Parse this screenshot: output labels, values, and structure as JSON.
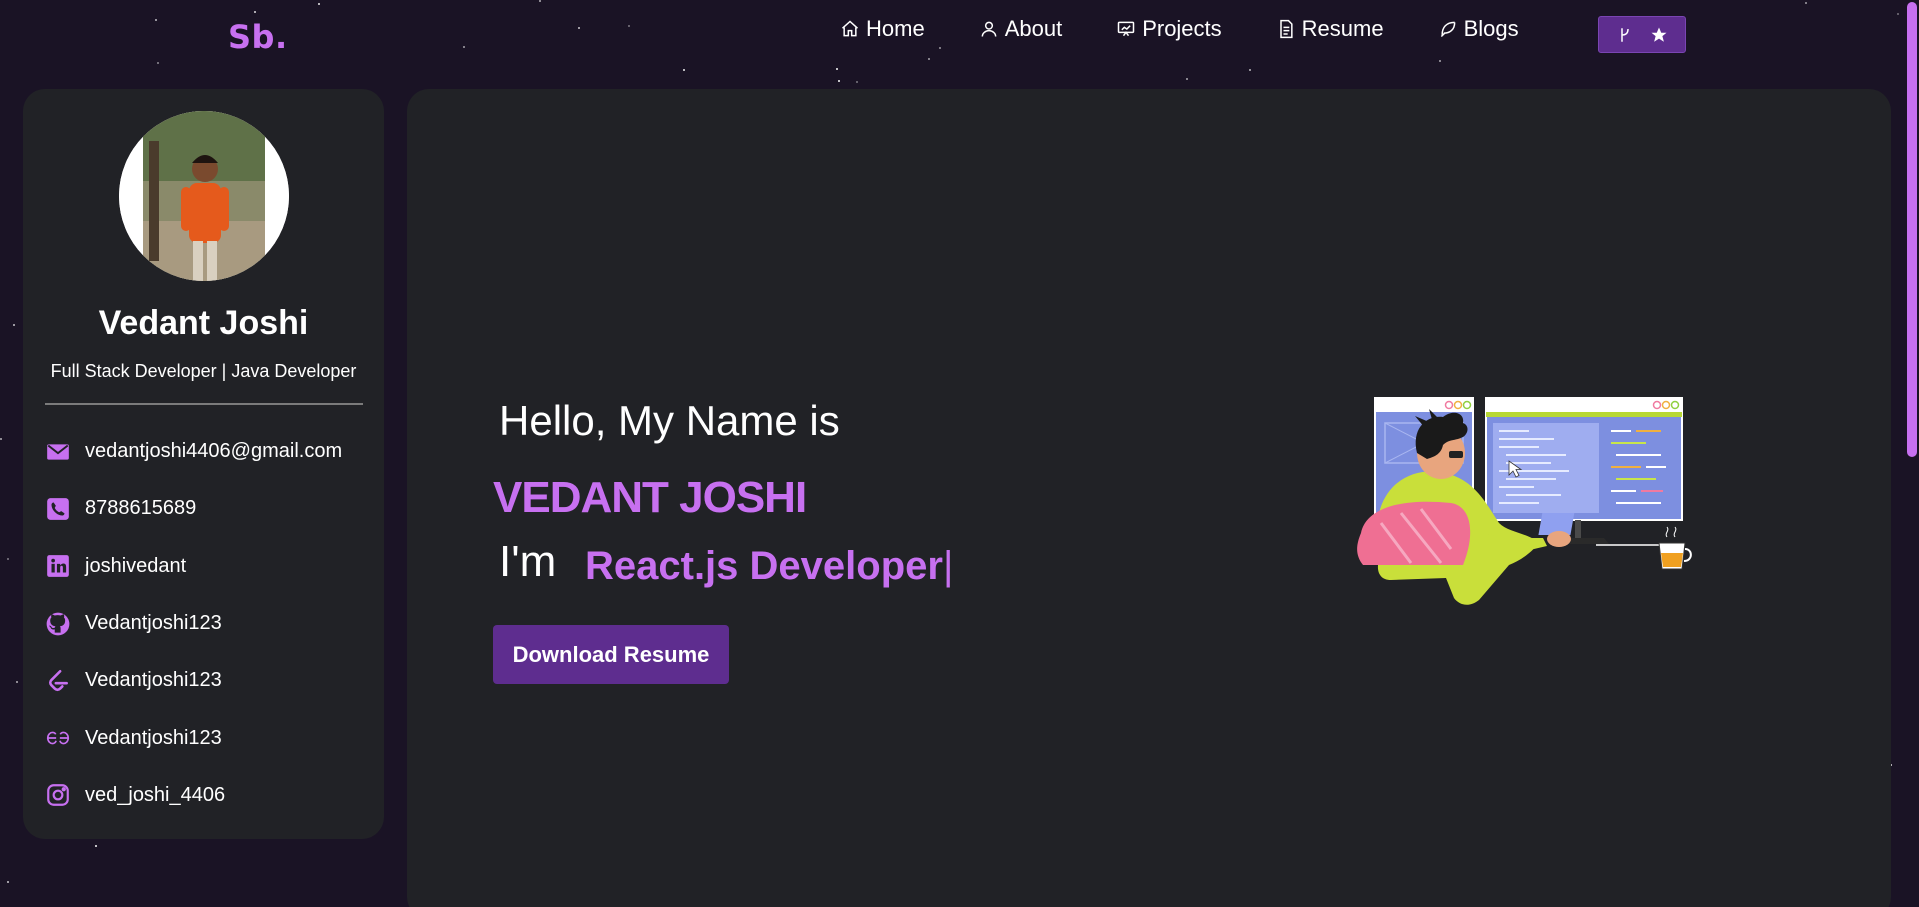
{
  "navbar": {
    "logo": "Sb.",
    "links": [
      {
        "label": "Home",
        "icon": "home-icon"
      },
      {
        "label": "About",
        "icon": "user-icon"
      },
      {
        "label": "Projects",
        "icon": "projects-icon"
      },
      {
        "label": "Resume",
        "icon": "document-icon"
      },
      {
        "label": "Blogs",
        "icon": "feather-icon"
      }
    ],
    "fork_button": {
      "icons": [
        "fork-icon",
        "star-icon"
      ]
    }
  },
  "sidebar": {
    "name": "Vedant Joshi",
    "role": "Full Stack Developer | Java Developer",
    "contacts": [
      {
        "icon": "mail-icon",
        "text": "vedantjoshi4406@gmail.com"
      },
      {
        "icon": "phone-icon",
        "text": "8788615689"
      },
      {
        "icon": "linkedin-icon",
        "text": "joshivedant"
      },
      {
        "icon": "github-icon",
        "text": "Vedantjoshi123"
      },
      {
        "icon": "leetcode-icon",
        "text": "Vedantjoshi123"
      },
      {
        "icon": "geeksforgeeks-icon",
        "text": "Vedantjoshi123"
      },
      {
        "icon": "instagram-icon",
        "text": "ved_joshi_4406"
      }
    ]
  },
  "hero": {
    "greeting": "Hello, My Name is",
    "name": "VEDANT JOSHI",
    "im": "I'm",
    "typed_text": "React.js Developer",
    "cursor": "|",
    "download_label": "Download Resume"
  },
  "colors": {
    "accent": "#c770f0",
    "button": "#5e2d8f",
    "background": "#1a1325",
    "panel": "#212226"
  }
}
